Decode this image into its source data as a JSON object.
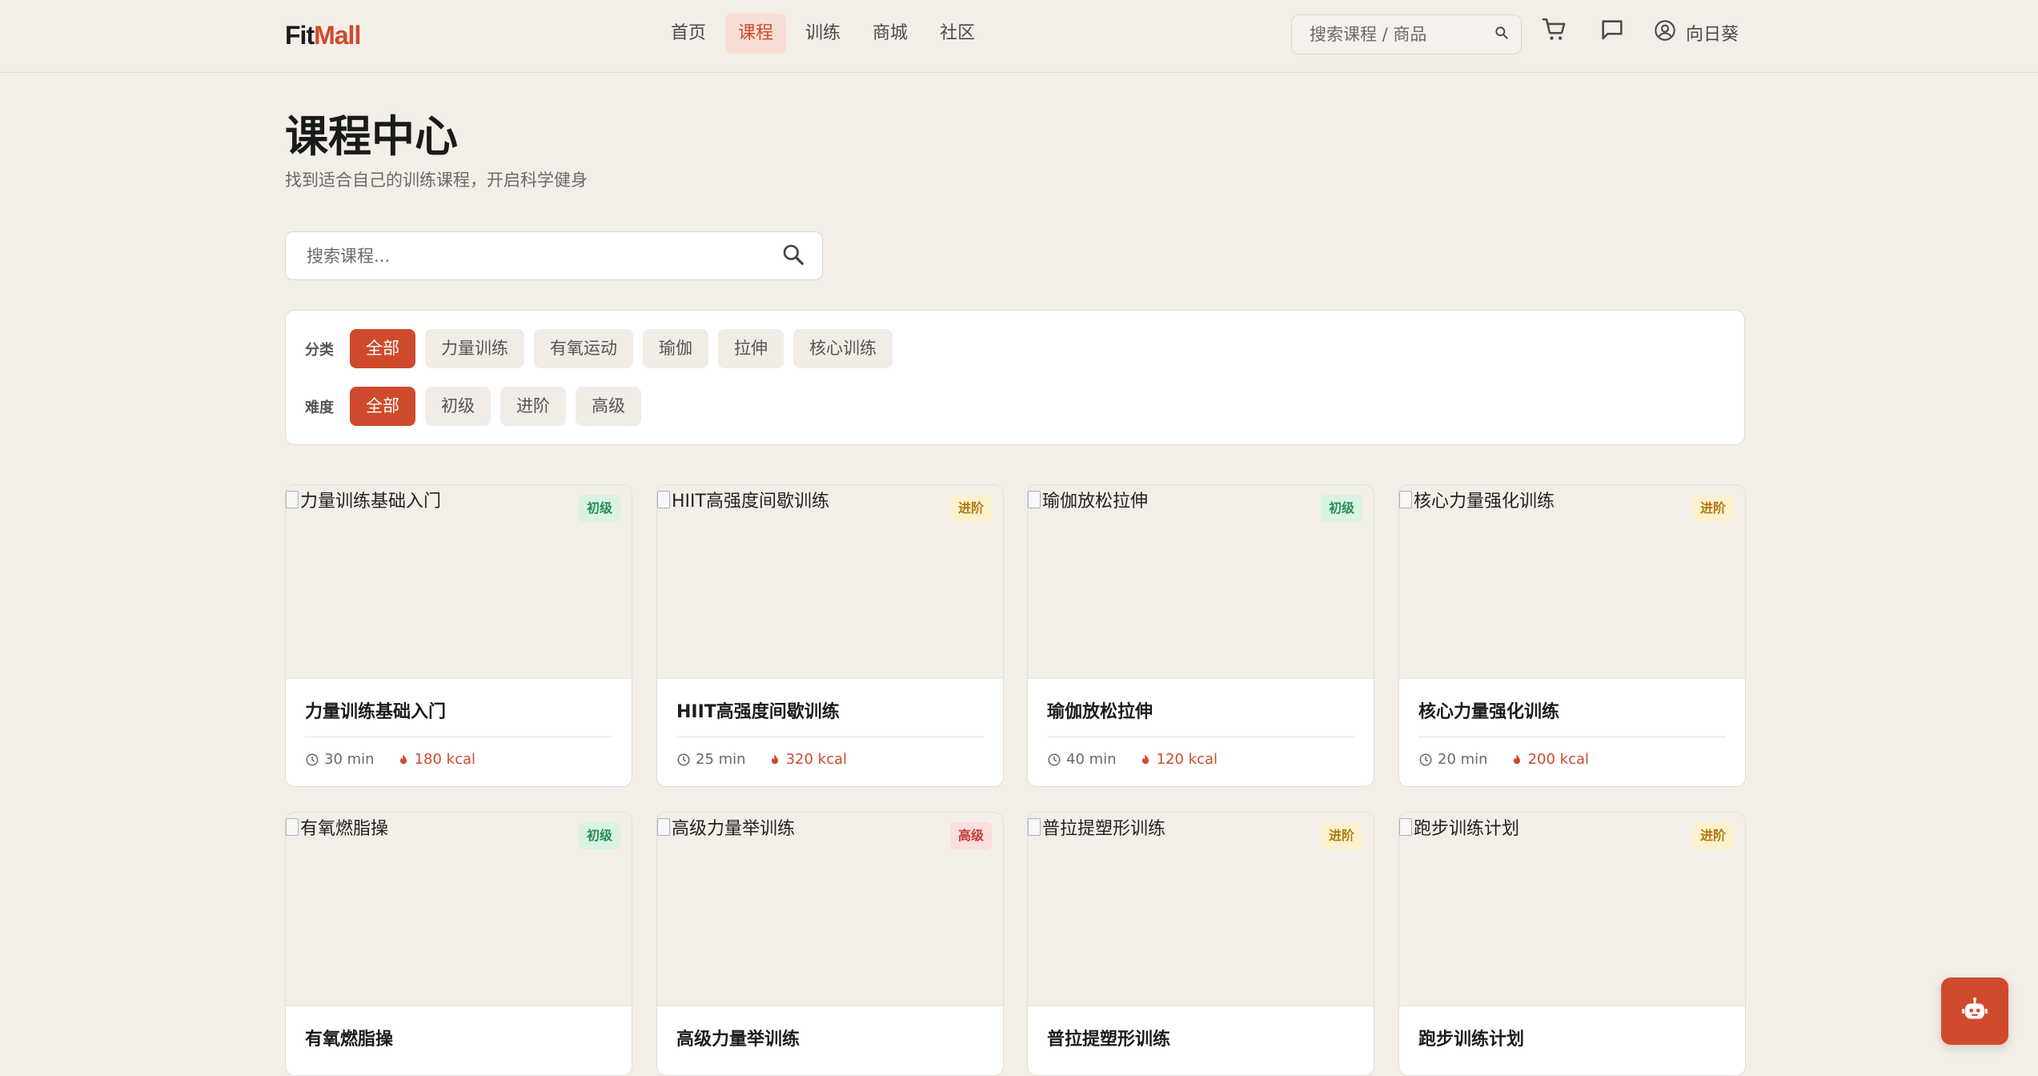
{
  "header": {
    "logo_part1": "Fit",
    "logo_part2": "Mall",
    "nav": [
      "首页",
      "课程",
      "训练",
      "商城",
      "社区"
    ],
    "active_nav": "课程",
    "search_placeholder": "搜索课程 / 商品",
    "user_name": "向日葵"
  },
  "page": {
    "title": "课程中心",
    "subtitle": "找到适合自己的训练课程，开启科学健身",
    "search_placeholder": "搜索课程..."
  },
  "filters": {
    "category_label": "分类",
    "categories": [
      "全部",
      "力量训练",
      "有氧运动",
      "瑜伽",
      "拉伸",
      "核心训练"
    ],
    "difficulty_label": "难度",
    "difficulties": [
      "全部",
      "初级",
      "进阶",
      "高级"
    ],
    "active_category": "全部",
    "active_difficulty": "全部"
  },
  "courses": [
    {
      "title": "力量训练基础入门",
      "level": "初级",
      "level_type": "beginner",
      "duration": "30 min",
      "kcal": "180 kcal"
    },
    {
      "title": "HIIT高强度间歇训练",
      "level": "进阶",
      "level_type": "intermediate",
      "duration": "25 min",
      "kcal": "320 kcal"
    },
    {
      "title": "瑜伽放松拉伸",
      "level": "初级",
      "level_type": "beginner",
      "duration": "40 min",
      "kcal": "120 kcal"
    },
    {
      "title": "核心力量强化训练",
      "level": "进阶",
      "level_type": "intermediate",
      "duration": "20 min",
      "kcal": "200 kcal"
    },
    {
      "title": "有氧燃脂操",
      "level": "初级",
      "level_type": "beginner"
    },
    {
      "title": "高级力量举训练",
      "level": "高级",
      "level_type": "advanced"
    },
    {
      "title": "普拉提塑形训练",
      "level": "进阶",
      "level_type": "intermediate"
    },
    {
      "title": "跑步训练计划",
      "level": "进阶",
      "level_type": "intermediate"
    }
  ],
  "colors": {
    "accent": "#cf4a2c",
    "background": "#f3eee8"
  },
  "icons": {
    "top_search": "search-icon",
    "cart": "cart-icon",
    "messages": "chat-icon",
    "user": "user-circle-icon",
    "fab": "robot-icon"
  }
}
